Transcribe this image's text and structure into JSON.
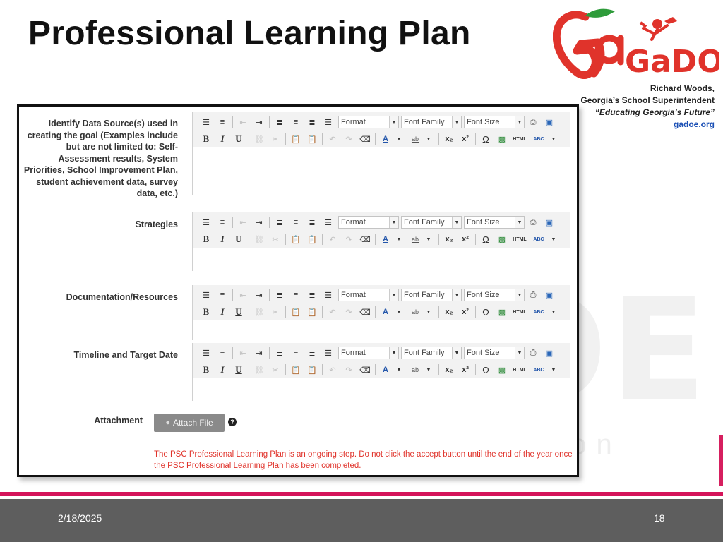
{
  "slide": {
    "title": "Professional Learning Plan",
    "date": "2/18/2025",
    "page_number": "18"
  },
  "branding": {
    "logo_text": "GaDOE",
    "watermark_text": "OE",
    "watermark_tail": "cation",
    "superintendent_name": "Richard Woods,",
    "superintendent_title": "Georgia’s School Superintendent",
    "motto": "“Educating Georgia’s Future”",
    "website": "gadoe.org",
    "colors": {
      "red": "#e0332b",
      "green": "#2e9b3a",
      "pink": "#d4145a",
      "footer": "#5e5e5e"
    }
  },
  "toolbar": {
    "format": "Format",
    "font_family": "Font Family",
    "font_size": "Font Size",
    "bold": "B",
    "italic": "I",
    "underline": "U",
    "html": "HTML",
    "abc": "ABC"
  },
  "form": {
    "sections": [
      {
        "label": "Identify Data Source(s) used in creating the goal (Examples include but are not limited to: Self-Assessment results, System Priorities, School Improvement Plan, student achievement data, survey data, etc.)"
      },
      {
        "label": "Strategies"
      },
      {
        "label": "Documentation/Resources"
      },
      {
        "label": "Timeline and Target Date"
      }
    ],
    "attachment_label": "Attachment",
    "attach_button": "Attach File",
    "warning": "The PSC Professional Learning Plan is an ongoing step.  Do not click the accept button until the end of the year once the PSC Professional Learning Plan has been completed."
  }
}
